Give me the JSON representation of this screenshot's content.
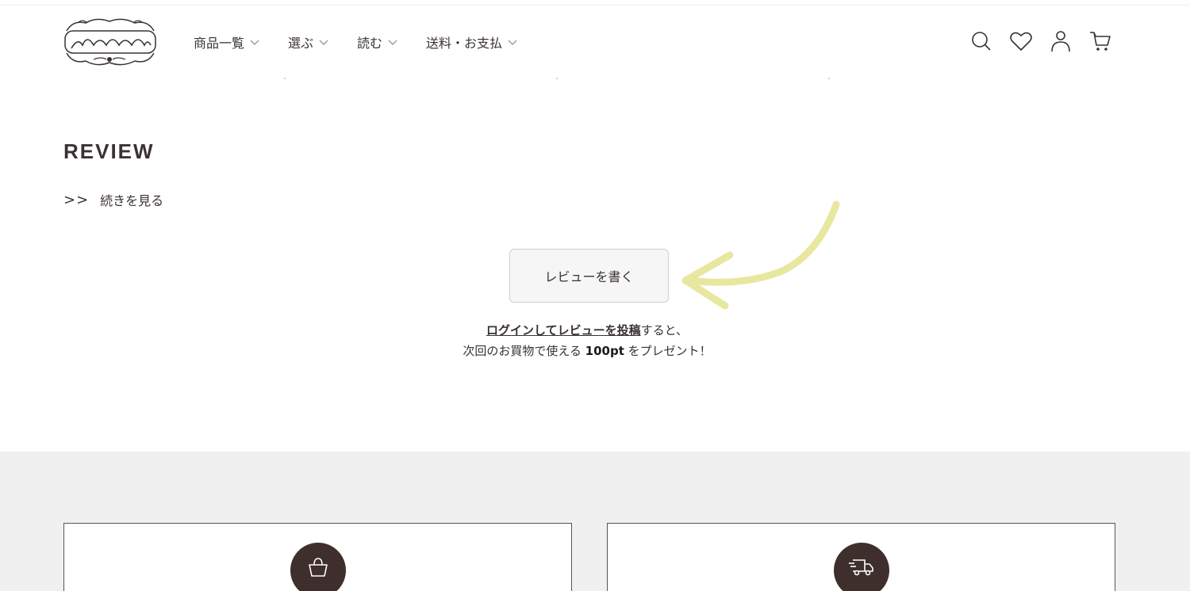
{
  "nav": {
    "items": [
      {
        "label": "商品一覧"
      },
      {
        "label": "選ぶ"
      },
      {
        "label": "読む"
      },
      {
        "label": "送料・お支払"
      }
    ]
  },
  "header_icons": [
    "search-icon",
    "heart-icon",
    "user-icon",
    "cart-icon"
  ],
  "review": {
    "title": "REVIEW",
    "more_arrows": ">>",
    "more_label": "続きを見る",
    "write_button": "レビューを書く",
    "note_link": "ログインしてレビューを投稿",
    "note_after_link": "すると、",
    "note_line2_pre": "次回のお買物で使える ",
    "note_points": "100pt",
    "note_line2_post": " をプレゼント！"
  },
  "cards": [
    {
      "icon": "shopping-bag-icon"
    },
    {
      "icon": "delivery-truck-icon"
    }
  ],
  "colors": {
    "text": "#3a3232",
    "button_bg": "#f6f6f6",
    "arrow": "#e8e79f",
    "icon_circle": "#3e2f2d",
    "gray_section": "#f0f0f0"
  }
}
